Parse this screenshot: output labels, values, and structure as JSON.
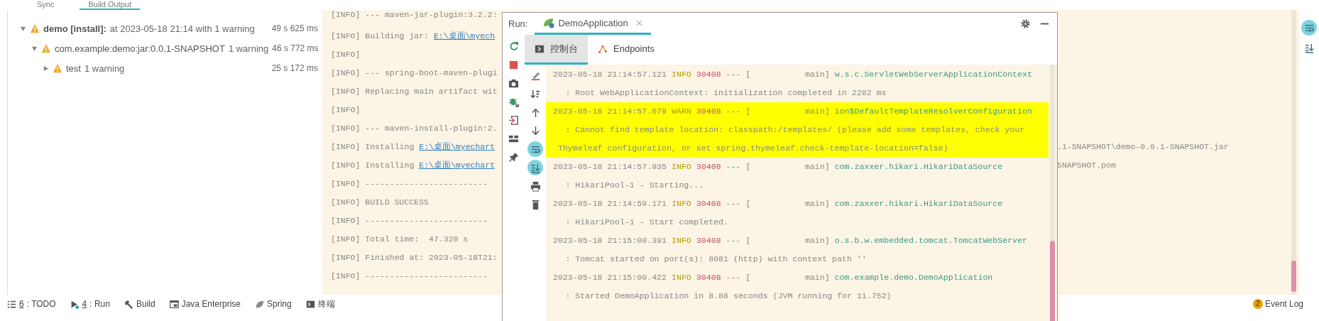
{
  "top_tabs": [
    {
      "label": "Sync",
      "selected": false
    },
    {
      "label": "Build Output",
      "selected": true
    }
  ],
  "build_tree": [
    {
      "label": "demo [install]:",
      "detail": "at 2023-05-18 21:14 with 1 warning",
      "time": "49 s 625 ms",
      "expanded": true,
      "children": [
        {
          "label": "com.example:demo:jar:0.0.1-SNAPSHOT",
          "detail": "1 warning",
          "time": "46 s 772 ms",
          "expanded": true,
          "children": [
            {
              "label": "test",
              "detail": "1 warning",
              "time": "25 s 172 ms",
              "expanded": false
            }
          ]
        }
      ]
    }
  ],
  "build_console": [
    {
      "text": "[INFO] --- maven-jar-plugin:3.2.2:"
    },
    {
      "text": "[INFO] Building jar: ",
      "link": "E:\\桌面\\myech"
    },
    {
      "text": "[INFO]"
    },
    {
      "text": "[INFO] --- spring-boot-maven-plugi"
    },
    {
      "text": "[INFO] Replacing main artifact wit"
    },
    {
      "text": "[INFO]"
    },
    {
      "text": "[INFO] --- maven-install-plugin:2."
    },
    {
      "text": "[INFO] Installing ",
      "link": "E:\\桌面\\myechart",
      "tail": ".1-SNAPSHOT\\demo-0.0.1-SNAPSHOT.jar"
    },
    {
      "text": "[INFO] Installing ",
      "link": "E:\\桌面\\myechart",
      "tail": "SNAPSHOT.pom"
    },
    {
      "text": "[INFO] -------------------------"
    },
    {
      "text": "[INFO] BUILD SUCCESS"
    },
    {
      "text": "[INFO] -------------------------"
    },
    {
      "text": "[INFO] Total time:  47.320 s"
    },
    {
      "text": "[INFO] Finished at: 2023-05-18T21:"
    },
    {
      "text": "[INFO] -------------------------"
    }
  ],
  "console_toolbar": [
    {
      "kind": "wrap",
      "on": true
    },
    {
      "kind": "scroll_end",
      "on": false
    }
  ],
  "run_window": {
    "title": "Run:",
    "tabs": [
      {
        "label": "DemoApplication",
        "selected": true
      }
    ],
    "subtabs": [
      {
        "kind": "console",
        "label": "控制台",
        "selected": true
      },
      {
        "kind": "endpoints",
        "label": "Endpoints",
        "selected": false
      }
    ],
    "tools_left": [
      {
        "kind": "rerun",
        "on": false
      },
      {
        "kind": "stop",
        "on": false
      },
      {
        "kind": "camera",
        "on": false
      },
      {
        "kind": "debug",
        "on": false
      },
      {
        "kind": "login",
        "on": false
      },
      {
        "kind": "layout",
        "on": false
      },
      {
        "kind": "pin",
        "on": false
      }
    ],
    "tools_right": [
      {
        "kind": "clear",
        "on": false
      },
      {
        "kind": "sort",
        "on": false
      },
      {
        "kind": "up",
        "on": false
      },
      {
        "kind": "down",
        "on": false
      },
      {
        "kind": "wrap",
        "on": true
      },
      {
        "kind": "scroll_end",
        "on": true
      },
      {
        "kind": "print",
        "on": false
      },
      {
        "kind": "trash",
        "on": false
      }
    ],
    "log": [
      {
        "time": "2023-05-18 21:14:57.121",
        "level": "INFO",
        "pid": "30408",
        "thread": "--- [           main]",
        "logger": "w.s.c.ServletWebServerApplicationContext",
        "message_lines": [
          ": Root WebApplicationContext: initialization completed in 2282 ms"
        ],
        "highlighted": false
      },
      {
        "time": "2023-05-18 21:14:57.679",
        "level": "WARN",
        "pid": "30408",
        "thread": "--- [           main]",
        "logger": "ion$DefaultTemplateResolverConfiguration",
        "message_lines": [
          ": Cannot find template location: classpath:/templates/ (please add some templates, check your",
          "Thymeleaf configuration, or set spring.thymeleaf.check-template-location=false)"
        ],
        "highlighted": true
      },
      {
        "time": "2023-05-18 21:14:57.935",
        "level": "INFO",
        "pid": "30408",
        "thread": "--- [           main]",
        "logger": "com.zaxxer.hikari.HikariDataSource",
        "message_lines": [
          ": HikariPool-1 - Starting..."
        ],
        "highlighted": false
      },
      {
        "time": "2023-05-18 21:14:59.171",
        "level": "INFO",
        "pid": "30408",
        "thread": "--- [           main]",
        "logger": "com.zaxxer.hikari.HikariDataSource",
        "message_lines": [
          ": HikariPool-1 - Start completed."
        ],
        "highlighted": false
      },
      {
        "time": "2023-05-18 21:15:00.391",
        "level": "INFO",
        "pid": "30408",
        "thread": "--- [           main]",
        "logger": "o.s.b.w.embedded.tomcat.TomcatWebServer",
        "message_lines": [
          ": Tomcat started on port(s): 8081 (http) with context path ''"
        ],
        "highlighted": false
      },
      {
        "time": "2023-05-18 21:15:00.422",
        "level": "INFO",
        "pid": "30408",
        "thread": "--- [           main]",
        "logger": "com.example.demo.DemoApplication",
        "message_lines": [
          ": Started DemoApplication in 8.88 seconds (JVM running for 11.752)"
        ],
        "highlighted": false
      }
    ]
  },
  "bottom_tools": [
    {
      "kind": "todo",
      "mnemonic": "6",
      "label": ": TODO"
    },
    {
      "kind": "run",
      "mnemonic": "4",
      "label": ": Run"
    },
    {
      "kind": "build",
      "label": "Build"
    },
    {
      "kind": "java_enterprise",
      "label": "Java Enterprise"
    },
    {
      "kind": "spring",
      "label": "Spring"
    },
    {
      "kind": "terminal",
      "label": "终端"
    }
  ],
  "event_log": {
    "badge": "2",
    "label": "Event Log"
  }
}
